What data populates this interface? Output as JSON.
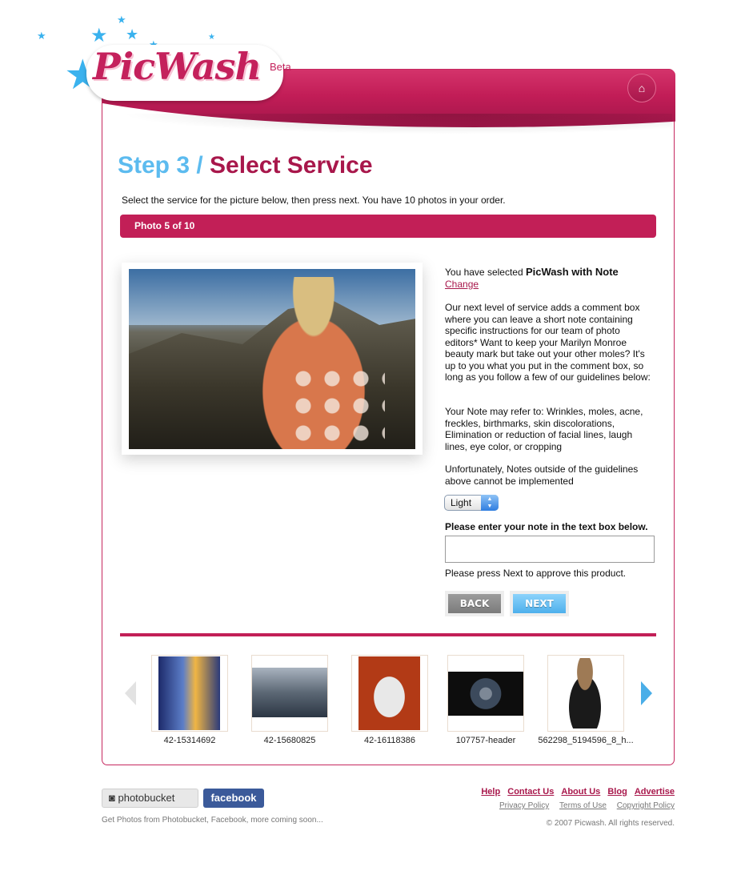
{
  "brand": {
    "name": "PicWash",
    "tag": "Beta"
  },
  "header": {
    "home_icon": "home-icon"
  },
  "step": {
    "number": "Step 3 /",
    "title": "Select Service"
  },
  "instructions": "Select the service for the picture below, then press next. You have 10 photos in your order.",
  "photo_bar": "Photo 5 of 10",
  "selection": {
    "prefix": "You have selected",
    "service": "PicWash with Note",
    "change_label": "Change"
  },
  "description": {
    "para1": "Our next level of service adds a comment box where you can leave a short note containing specific instructions for our team of photo editors* Want to keep your Marilyn Monroe beauty mark but take out your other moles? It's up to you what you put in the comment box, so long as you follow a few of our guidelines below:",
    "para2": "Your Note may refer to: Wrinkles, moles, acne, freckles, birthmarks, skin discolorations, Elimination or reduction of facial lines, laugh lines, eye color, or cropping",
    "para3": "Unfortunately, Notes outside of the guidelines above cannot be implemented"
  },
  "intensity_select": {
    "value": "Light"
  },
  "note": {
    "label": "Please enter your note in the text box below.",
    "value": ""
  },
  "press_next": "Please press Next to approve this product.",
  "buttons": {
    "back": "BACK",
    "next": "NEXT"
  },
  "thumbnails": [
    {
      "label": "42-15314692"
    },
    {
      "label": "42-15680825"
    },
    {
      "label": "42-16118386"
    },
    {
      "label": "107757-header"
    },
    {
      "label": "562298_5194596_8_h..."
    }
  ],
  "footer": {
    "photobucket": "photobucket",
    "facebook": "facebook",
    "sources_note": "Get Photos from Photobucket, Facebook, more coming soon...",
    "links": [
      "Help",
      "Contact Us",
      "About Us",
      "Blog",
      "Advertise"
    ],
    "policies": [
      "Privacy Policy",
      "Terms of Use",
      "Copyright Policy"
    ],
    "copyright": "© 2007 Picwash. All rights reserved."
  },
  "colors": {
    "brand": "#c21f57",
    "accent_blue": "#5cbbef",
    "title_dark": "#a8174b"
  }
}
